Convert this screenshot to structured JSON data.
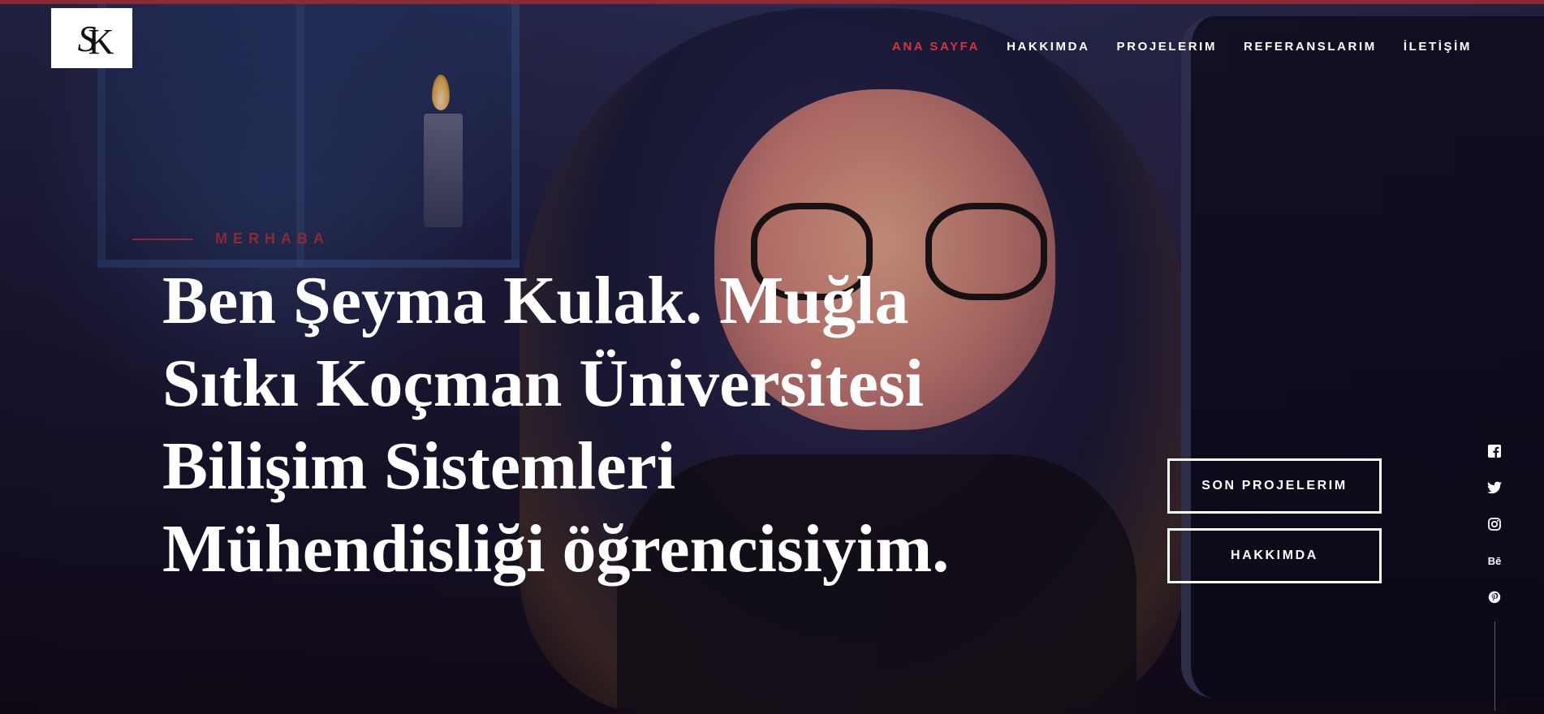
{
  "logo": {
    "letter_1": "S",
    "letter_2": "K"
  },
  "nav": {
    "items": [
      {
        "label": "ANA SAYFA",
        "active": true
      },
      {
        "label": "HAKKIMDA",
        "active": false
      },
      {
        "label": "PROJELERIM",
        "active": false
      },
      {
        "label": "REFERANSLARIM",
        "active": false
      },
      {
        "label": "İLETİŞİM",
        "active": false
      }
    ]
  },
  "hero": {
    "eyebrow": "MERHABA",
    "headline": "Ben Şeyma Kulak. Muğla Sıtkı Koçman Üniversitesi Bilişim Sistemleri Mühendisliği öğrencisiyim."
  },
  "actions": {
    "primary": "SON PROJELERIM",
    "secondary": "HAKKIMDA"
  },
  "social": {
    "icons": [
      "facebook-icon",
      "twitter-icon",
      "instagram-icon",
      "behance-icon",
      "pinterest-icon"
    ],
    "behance_text": "Bē"
  },
  "colors": {
    "accent": "#d2363d",
    "accent_dark": "#8b2a32",
    "text": "#ffffff"
  }
}
